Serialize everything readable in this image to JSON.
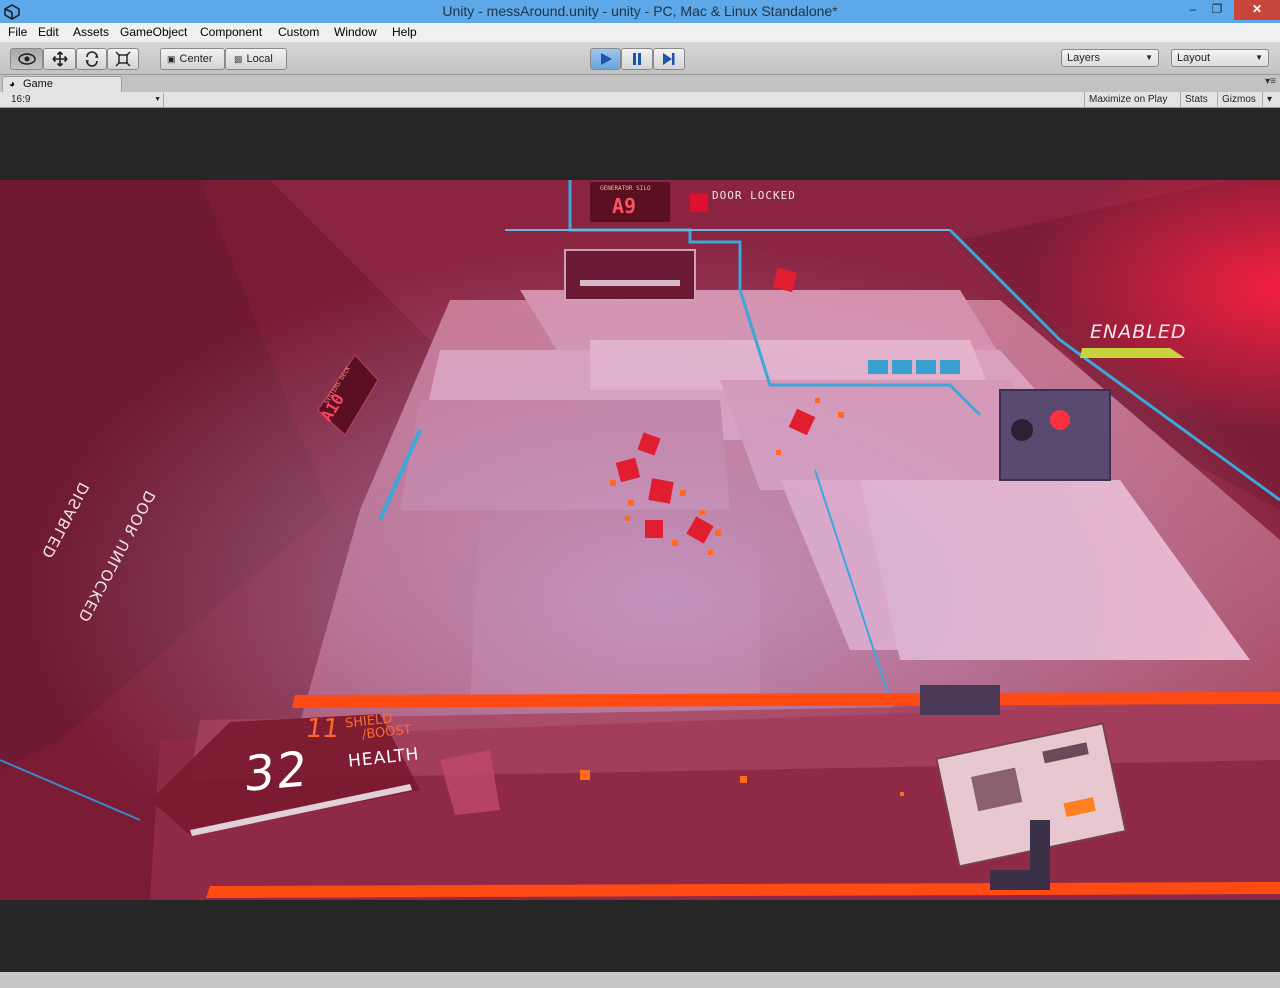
{
  "window": {
    "title": "Unity - messAround.unity - unity - PC, Mac & Linux Standalone*",
    "minimize": "–",
    "maximize": "❐",
    "close": "✕"
  },
  "menu": [
    "File",
    "Edit",
    "Assets",
    "GameObject",
    "Component",
    "Custom",
    "Window",
    "Help"
  ],
  "toolbar": {
    "pivot_label": "Center",
    "space_label": "Local",
    "layers_label": "Layers",
    "layout_label": "Layout"
  },
  "game_tab": {
    "label": "Game",
    "aspect": "16:9",
    "maximize_on_play": "Maximize on Play",
    "stats": "Stats",
    "gizmos": "Gizmos"
  },
  "hud": {
    "shield_value": "11",
    "shield_label": "SHIELD",
    "boost_label": "/BOOST",
    "health_value": "32",
    "health_label": "HEALTH",
    "enabled_label": "ENABLED",
    "door_locked": "DOOR LOCKED",
    "door_unlocked": "DOOR UNLOCKED",
    "disabled_label": "DISABLED",
    "silo_sign": "GENERATOR SILO",
    "silo_code": "A9",
    "deck_sign": "SYSTEMS DECK",
    "deck_code": "A10"
  },
  "colors": {
    "accent_play": "#6aa4dc",
    "hud_orange": "#ff5a1e",
    "enabled_yellow": "#c8d23c",
    "floor_pink": "#d8809a",
    "wall_red": "#7a1e30"
  }
}
